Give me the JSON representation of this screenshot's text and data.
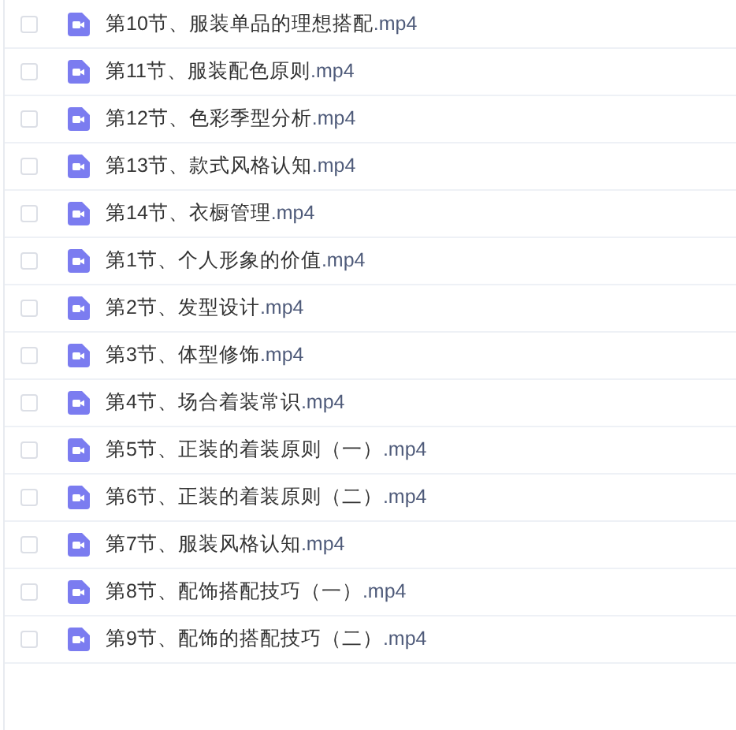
{
  "files": [
    {
      "name": "第10节、服装单品的理想搭配",
      "extension": ".mp4",
      "checked": false
    },
    {
      "name": "第11节、服装配色原则",
      "extension": ".mp4",
      "checked": false
    },
    {
      "name": "第12节、色彩季型分析",
      "extension": ".mp4",
      "checked": false
    },
    {
      "name": "第13节、款式风格认知",
      "extension": ".mp4",
      "checked": false
    },
    {
      "name": "第14节、衣橱管理",
      "extension": ".mp4",
      "checked": false
    },
    {
      "name": "第1节、个人形象的价值",
      "extension": ".mp4",
      "checked": false
    },
    {
      "name": "第2节、发型设计",
      "extension": ".mp4",
      "checked": false
    },
    {
      "name": "第3节、体型修饰",
      "extension": ".mp4",
      "checked": false
    },
    {
      "name": "第4节、场合着装常识",
      "extension": ".mp4",
      "checked": false
    },
    {
      "name": "第5节、正装的着装原则（一）",
      "extension": ".mp4",
      "checked": false
    },
    {
      "name": "第6节、正装的着装原则（二）",
      "extension": ".mp4",
      "checked": false
    },
    {
      "name": "第7节、服装风格认知",
      "extension": ".mp4",
      "checked": false
    },
    {
      "name": "第8节、配饰搭配技巧（一）",
      "extension": ".mp4",
      "checked": false
    },
    {
      "name": "第9节、配饰的搭配技巧（二）",
      "extension": ".mp4",
      "checked": false
    }
  ]
}
